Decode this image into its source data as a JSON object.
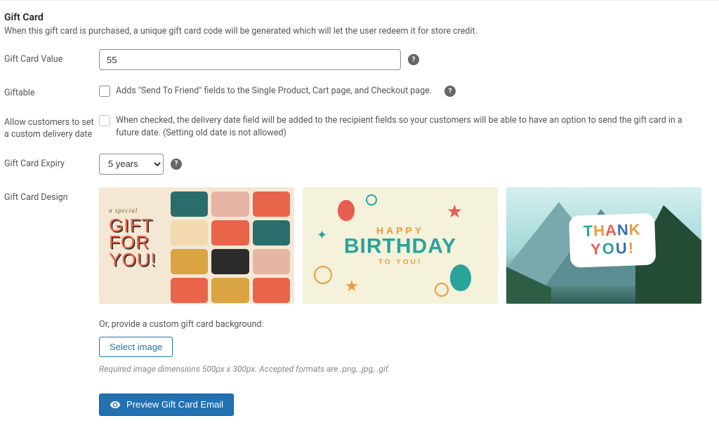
{
  "section": {
    "title": "Gift Card",
    "description": "When this gift card is purchased, a unique gift card code will be generated which will let the user redeem it for store credit."
  },
  "fields": {
    "value": {
      "label": "Gift Card Value",
      "value": "55"
    },
    "giftable": {
      "label": "Giftable",
      "description": "Adds \"Send To Friend\" fields to the Single Product, Cart page, and Checkout page."
    },
    "custom_date": {
      "label": "Allow customers to set a custom delivery date",
      "description": "When checked, the delivery date field will be added to the recipient fields so your customers will be able to have an option to send the gift card in a future date. (Setting old date is not allowed)"
    },
    "expiry": {
      "label": "Gift Card Expiry",
      "selected": "5 years"
    },
    "design": {
      "label": "Gift Card Design",
      "card1_tag": "a special",
      "card1_main": "GIFT\nFOR\nYOU!",
      "card2_happy": "HAPPY",
      "card2_birthday": "BIRTHDAY",
      "card2_toyou": "TO YOU!",
      "card3_thank": "THANK",
      "card3_you": "YOU!",
      "custom_label": "Or, provide a custom gift card background:",
      "select_image": "Select image",
      "hint": "Required image dimensions 500px x 300px. Accepted formats are .png, .jpg, .gif."
    }
  },
  "actions": {
    "preview": "Preview Gift Card Email"
  }
}
